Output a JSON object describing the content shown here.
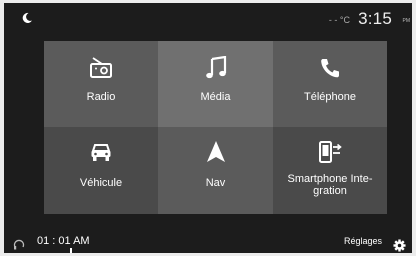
{
  "status": {
    "temperature": "- - °C",
    "time": "3:15",
    "ampm": "PM"
  },
  "tiles": [
    {
      "label": "Radio",
      "icon": "radio-icon"
    },
    {
      "label": "Média",
      "icon": "music-note-icon"
    },
    {
      "label": "Téléphone",
      "icon": "phone-icon"
    },
    {
      "label": "Véhicule",
      "icon": "car-icon"
    },
    {
      "label": "Nav",
      "icon": "navigation-arrow-icon"
    },
    {
      "label": "Smartphone Inte-gration",
      "icon": "smartphone-projection-icon"
    }
  ],
  "bottom": {
    "time": "01 : 01 AM",
    "settings_label": "Réglages"
  },
  "colors": {
    "background": "#1c1c1c",
    "tile_light": "#707070",
    "tile_mid": "#5b5b5b",
    "tile_dark": "#4a4a4a"
  }
}
